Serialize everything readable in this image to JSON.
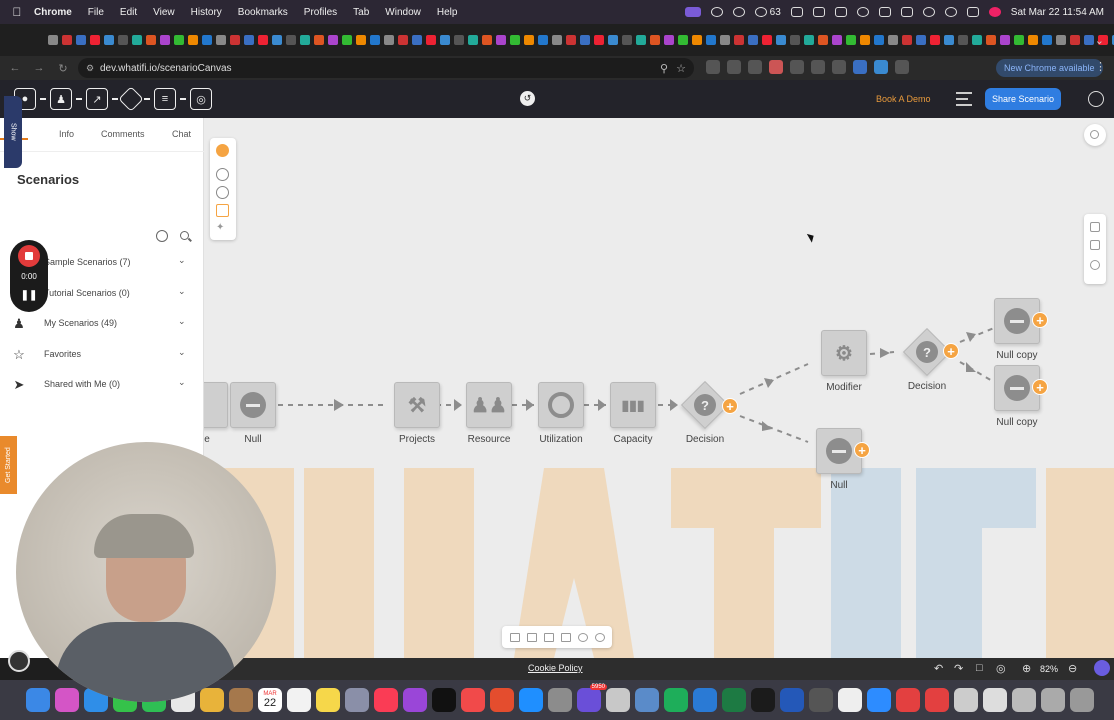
{
  "menubar": {
    "app": "Chrome",
    "items": [
      "File",
      "Edit",
      "View",
      "History",
      "Bookmarks",
      "Profiles",
      "Tab",
      "Window",
      "Help"
    ],
    "notification_count": "63",
    "clock": "Sat Mar 22  11:54 AM"
  },
  "browser": {
    "url": "dev.whatifi.io/scenarioCanvas",
    "update_label": "New Chrome available"
  },
  "header": {
    "book_demo": "Book A Demo",
    "share_button": "Share Scenario"
  },
  "left_panel": {
    "show_tab": "Show",
    "tabs": [
      "Info",
      "Comments",
      "Chat"
    ],
    "title": "Scenarios",
    "folders": [
      {
        "label": "Sample Scenarios (7)",
        "icon": "folder-icon"
      },
      {
        "label": "Tutorial Scenarios (0)",
        "icon": "folder-icon"
      },
      {
        "label": "My Scenarios (49)",
        "icon": "person-icon"
      },
      {
        "label": "Favorites",
        "icon": "star-icon"
      },
      {
        "label": "Shared with Me (0)",
        "icon": "send-icon"
      }
    ],
    "get_started": "Get Started"
  },
  "recorder": {
    "time": "0:00"
  },
  "canvas": {
    "nodes": [
      {
        "id": "partial",
        "label": "e"
      },
      {
        "id": "null1",
        "label": "Null",
        "icon": "null-icon"
      },
      {
        "id": "projects",
        "label": "Projects",
        "icon": "hammer-icon"
      },
      {
        "id": "resource",
        "label": "Resource",
        "icon": "people-icon"
      },
      {
        "id": "utilization",
        "label": "Utilization",
        "icon": "ring-icon"
      },
      {
        "id": "capacity",
        "label": "Capacity",
        "icon": "battery-icon"
      },
      {
        "id": "decision1",
        "label": "Decision",
        "icon": "question-icon"
      },
      {
        "id": "modifier",
        "label": "Modifier",
        "icon": "wrench-icon"
      },
      {
        "id": "decision2",
        "label": "Decision",
        "icon": "question-icon"
      },
      {
        "id": "nullcopy1",
        "label": "Null copy",
        "icon": "null-icon"
      },
      {
        "id": "nullcopy2",
        "label": "Null copy",
        "icon": "null-icon"
      },
      {
        "id": "null2",
        "label": "Null",
        "icon": "null-icon"
      }
    ]
  },
  "footer": {
    "cookie_policy": "Cookie Policy",
    "zoom": "82%"
  },
  "dock": {
    "calendar_month": "MAR",
    "calendar_day": "22",
    "badge": "5950"
  }
}
